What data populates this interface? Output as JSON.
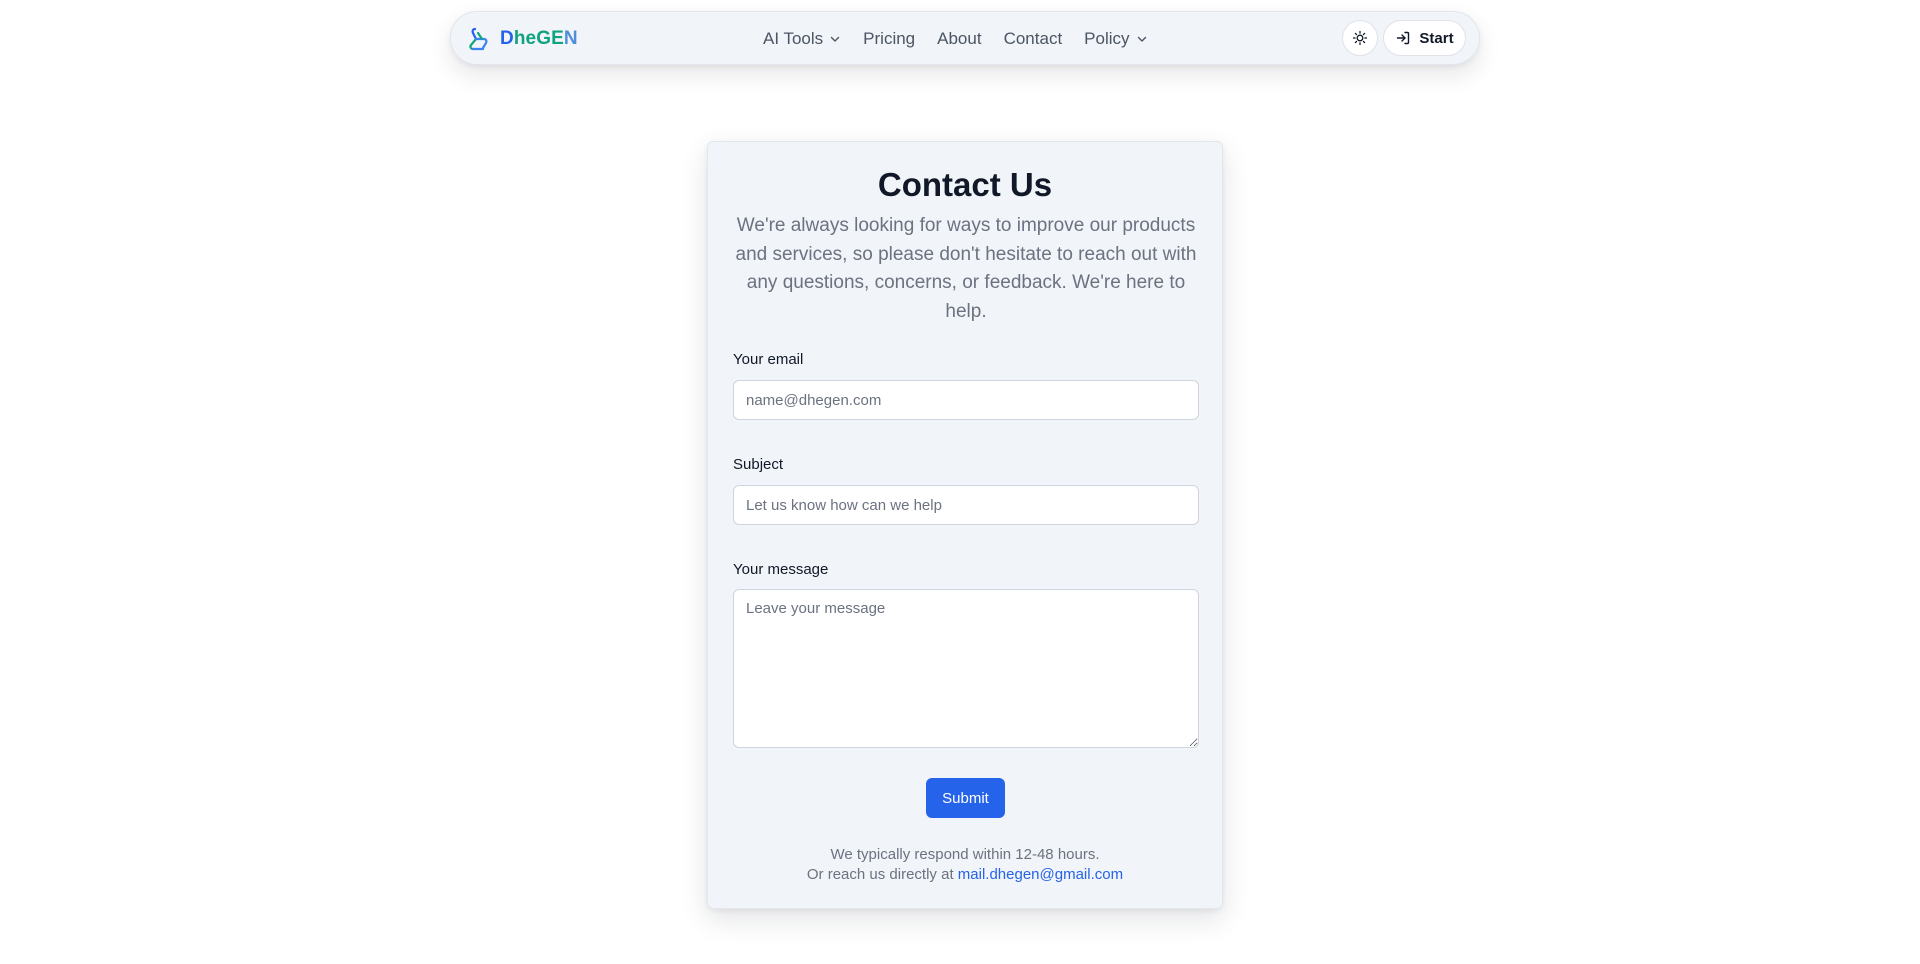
{
  "nav": {
    "brand": {
      "part1": "D",
      "part2": "heGE",
      "part3": "N",
      "logo_icon": "molecule-logo-icon"
    },
    "links": [
      {
        "label": "AI Tools",
        "has_dropdown": true
      },
      {
        "label": "Pricing",
        "has_dropdown": false
      },
      {
        "label": "About",
        "has_dropdown": false
      },
      {
        "label": "Contact",
        "has_dropdown": false
      },
      {
        "label": "Policy",
        "has_dropdown": true
      }
    ],
    "theme_toggle_icon": "sun-icon",
    "start_label": "Start",
    "start_icon": "login-arrow-icon"
  },
  "contact": {
    "title": "Contact Us",
    "description": "We're always looking for ways to improve our products and services, so please don't hesitate to reach out with any questions, concerns, or feedback. We're here to help.",
    "email_label": "Your email",
    "email_placeholder": "name@dhegen.com",
    "subject_label": "Subject",
    "subject_placeholder": "Let us know how can we help",
    "message_label": "Your message",
    "message_placeholder": "Leave your message",
    "submit_label": "Submit",
    "response_note": "We typically respond within 12-48 hours.",
    "reach_prefix": "Or reach us directly at",
    "email_address": "mail.dhegen@gmail.com"
  },
  "colors": {
    "accent": "#2563eb",
    "brand_green": "#10a37f",
    "card_bg": "#f1f4f8",
    "muted_text": "#6b7280"
  }
}
